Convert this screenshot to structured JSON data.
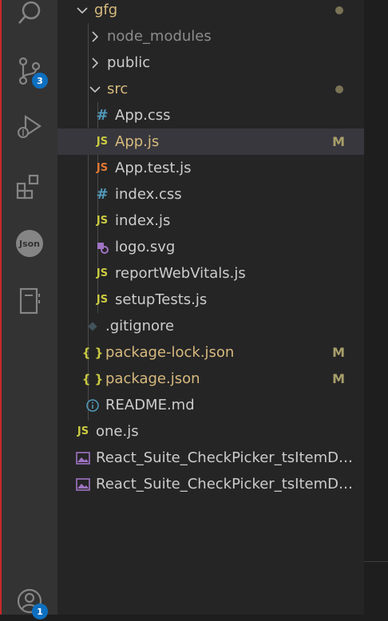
{
  "activity_bar": {
    "source_control_badge": "3",
    "accounts_badge": "1"
  },
  "explorer": {
    "folder": "gfg",
    "items": [
      {
        "label": "node_modules",
        "icon": "chevron-right-icon"
      },
      {
        "label": "public",
        "icon": "chevron-right-icon"
      },
      {
        "label": "src",
        "icon": "chevron-down-icon"
      },
      {
        "label": "App.css",
        "icon": "#"
      },
      {
        "label": "App.js",
        "icon": "JS",
        "status": "M"
      },
      {
        "label": "App.test.js",
        "icon": "JS"
      },
      {
        "label": "index.css",
        "icon": "#"
      },
      {
        "label": "index.js",
        "icon": "JS"
      },
      {
        "label": "logo.svg",
        "icon": "svg-file-icon"
      },
      {
        "label": "reportWebVitals.js",
        "icon": "JS"
      },
      {
        "label": "setupTests.js",
        "icon": "JS"
      },
      {
        "label": ".gitignore",
        "icon": "git-icon"
      },
      {
        "label": "package-lock.json",
        "icon": "{}",
        "status": "M"
      },
      {
        "label": "package.json",
        "icon": "{}",
        "status": "M"
      },
      {
        "label": "README.md",
        "icon": "info-icon"
      },
      {
        "label": "one.js",
        "icon": "JS"
      },
      {
        "label": "React_Suite_CheckPicker_tsItemData...",
        "icon": "image-icon"
      },
      {
        "label": "React_Suite_CheckPicker_tsItemData...",
        "icon": "image-icon"
      }
    ],
    "js_glyph": "JS",
    "css_glyph": "#",
    "json_glyph": "{ }",
    "json_ext_label": "Json"
  },
  "colors": {
    "modified": "#a89f6a",
    "selected_row": "#37373d",
    "badge": "#0e70c0"
  }
}
